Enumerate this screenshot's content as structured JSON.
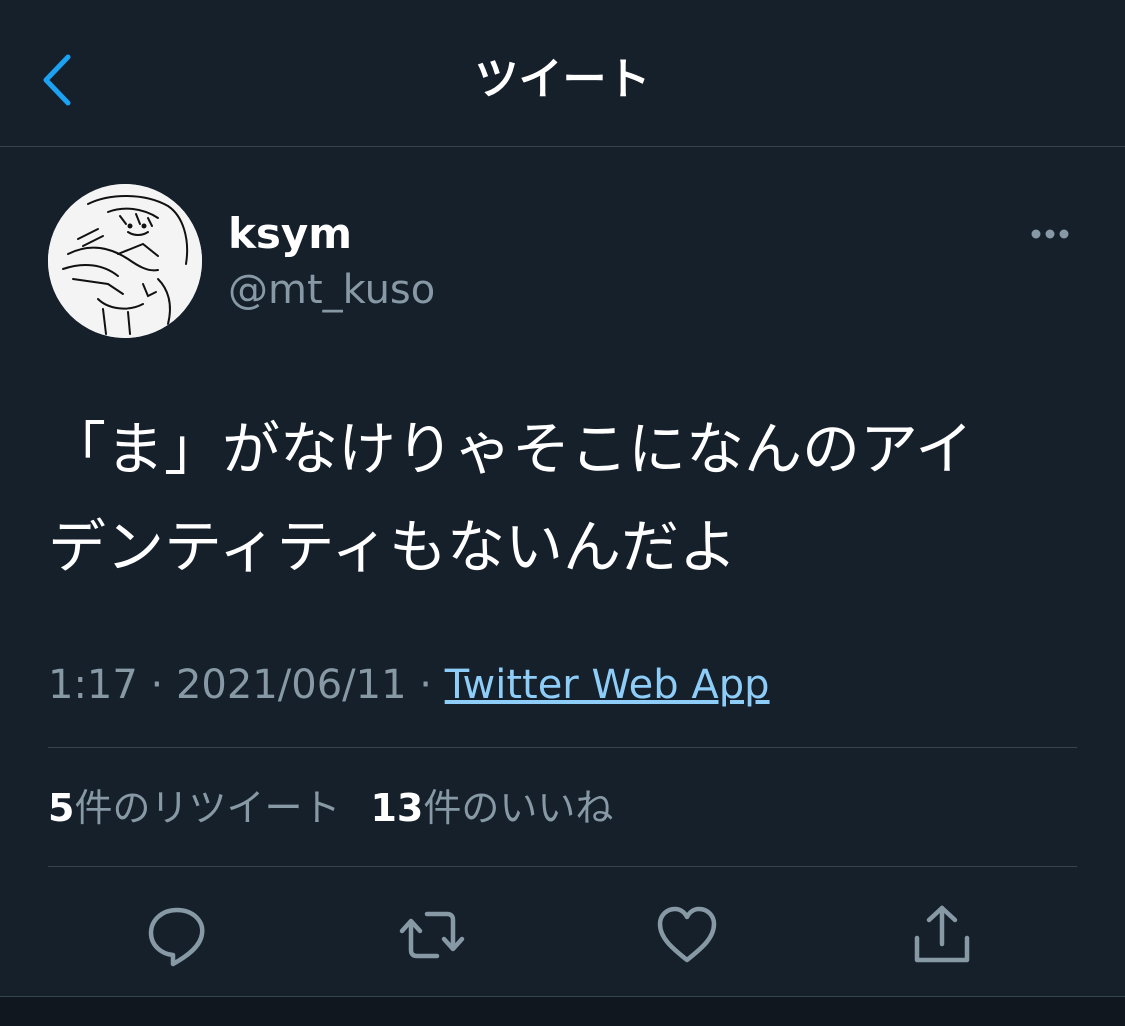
{
  "header": {
    "title": "ツイート",
    "back_icon": "chevron-left-icon"
  },
  "tweet": {
    "display_name": "ksym",
    "handle": "@mt_kuso",
    "text_line1": "「ま」がなけりゃそこになんのアイ",
    "text_line2": "デンティティもないんだよ",
    "time": "1:17",
    "date": "2021/06/11",
    "separator": "·",
    "source": "Twitter Web App"
  },
  "stats": {
    "retweet_count": "5",
    "retweet_label": "件のリツイート",
    "like_count": "13",
    "like_label": "件のいいね"
  },
  "actions": [
    {
      "name": "reply",
      "icon": "speech-bubble-icon"
    },
    {
      "name": "retweet",
      "icon": "retweet-arrows-icon"
    },
    {
      "name": "like",
      "icon": "heart-icon"
    },
    {
      "name": "share",
      "icon": "share-upload-icon"
    }
  ],
  "colors": {
    "background": "#15202b",
    "accent": "#1da1f2",
    "link": "#8ecdf8",
    "secondary_text": "#8899a6",
    "divider": "#38444d"
  }
}
